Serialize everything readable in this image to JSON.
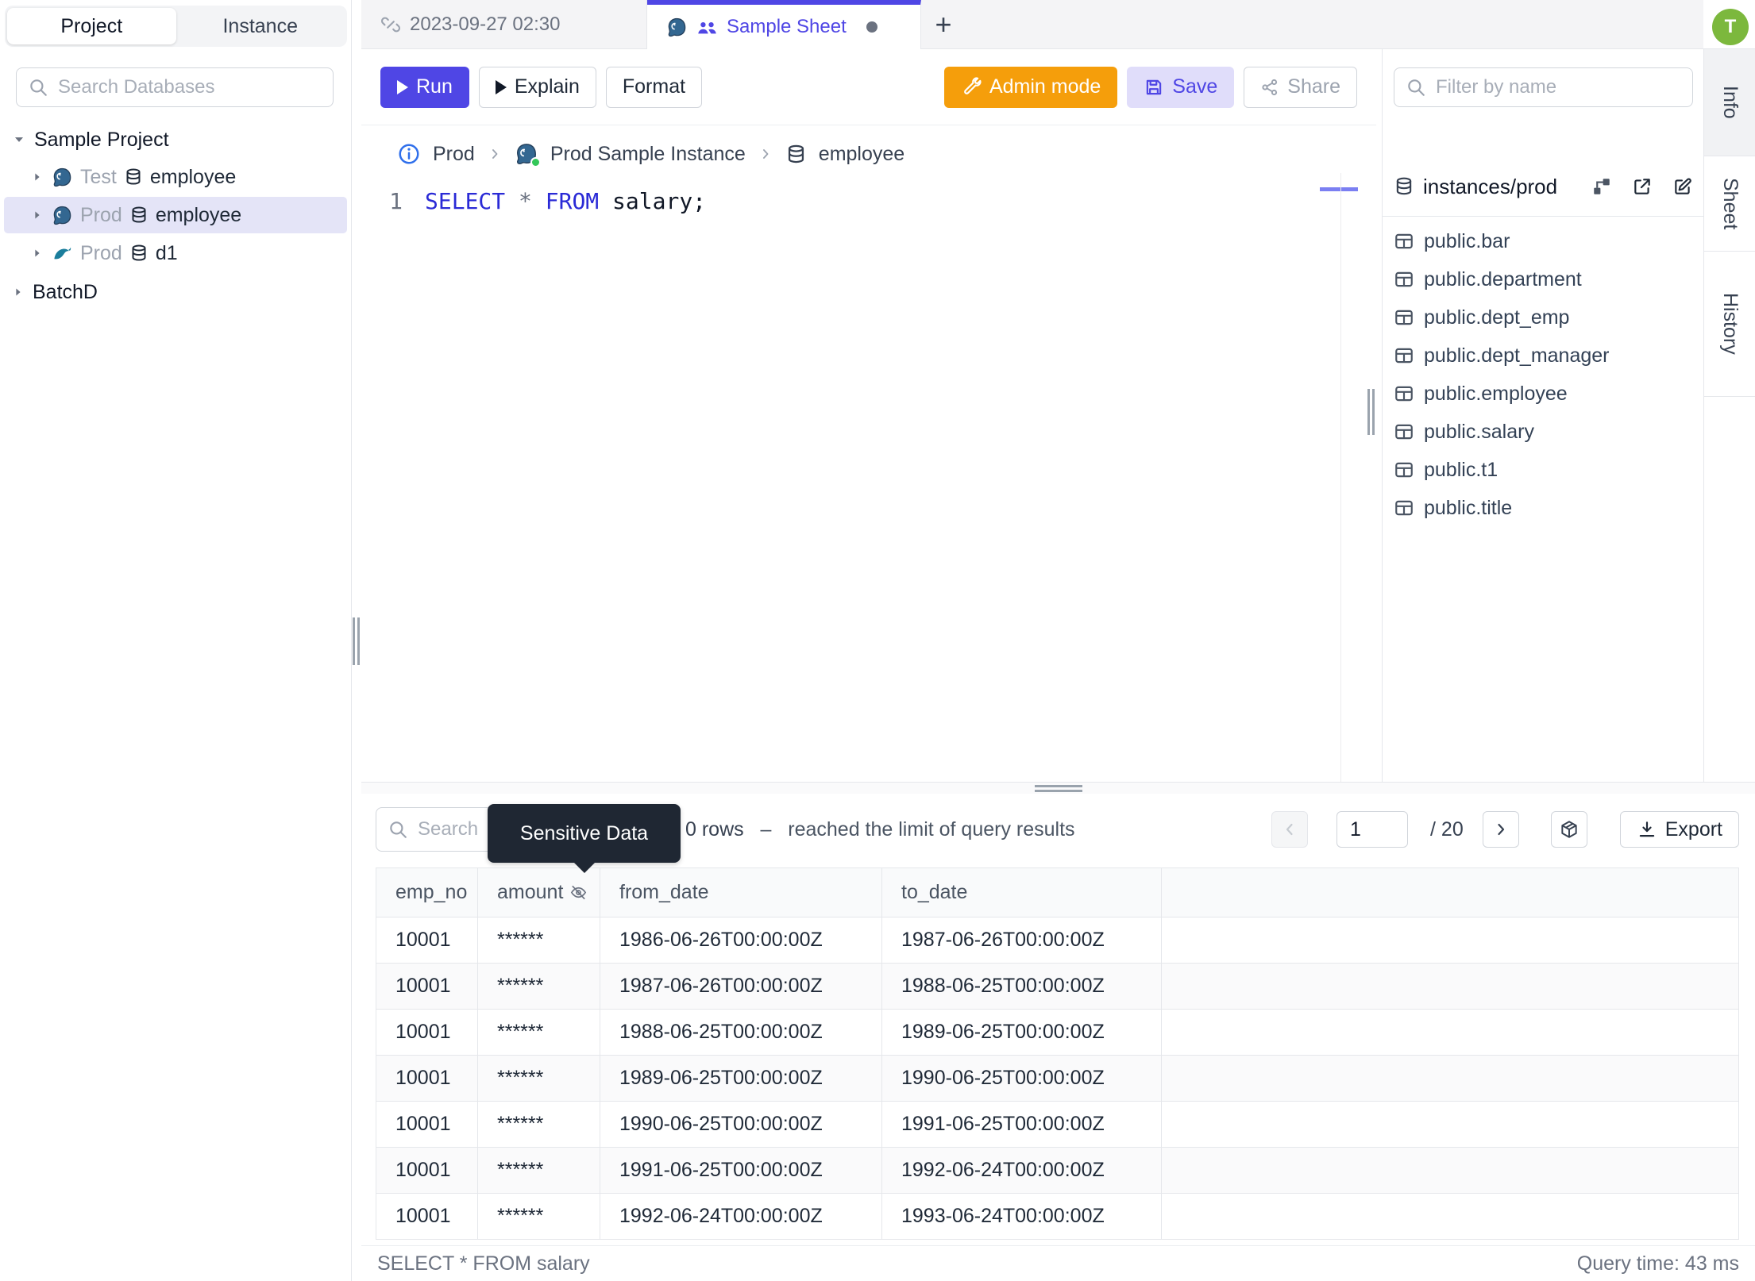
{
  "colors": {
    "accent": "#4f46e5",
    "admin_orange": "#f59e0b",
    "avatar_green": "#7cb83d",
    "keyword_blue": "#2a2ad6",
    "tooltip_bg": "#1f2733",
    "selected_row_bg": "#e4e4f7"
  },
  "left_sidebar": {
    "tab_project": "Project",
    "tab_instance": "Instance",
    "search_placeholder": "Search Databases",
    "tree_root": "Sample Project",
    "tree_items": [
      {
        "env": "Test",
        "db": "employee",
        "engine": "postgresql"
      },
      {
        "env": "Prod",
        "db": "employee",
        "engine": "postgresql"
      },
      {
        "env": "Prod",
        "db": "d1",
        "engine": "mysql"
      }
    ],
    "batch_item": "BatchD"
  },
  "tab_bar": {
    "tab1": "2023-09-27 02:30",
    "tab2": "Sample Sheet",
    "new_tab": "+"
  },
  "toolbar": {
    "run": "Run",
    "explain": "Explain",
    "format": "Format",
    "admin": "Admin mode",
    "save": "Save",
    "share": "Share"
  },
  "breadcrumb": {
    "env": "Prod",
    "instance": "Prod Sample Instance",
    "database": "employee"
  },
  "editor": {
    "line1_number": "1",
    "kw_select": "SELECT",
    "op_star": "*",
    "kw_from": "FROM",
    "tail": "salary;"
  },
  "right_sidebar": {
    "filter_placeholder": "Filter by name",
    "connection": "instances/prod",
    "tables": [
      "public.bar",
      "public.department",
      "public.dept_emp",
      "public.dept_manager",
      "public.employee",
      "public.salary",
      "public.t1",
      "public.title"
    ],
    "tab_info": "Info",
    "tab_sheet": "Sheet",
    "tab_history": "History"
  },
  "user": {
    "initial": "T"
  },
  "results": {
    "search_placeholder": "Search",
    "tooltip": "Sensitive Data",
    "row_count": "0 rows",
    "separator": "–",
    "limit_message": "reached the limit of query results",
    "page": "1",
    "page_total": "/ 20",
    "export": "Export",
    "columns": {
      "c1": "emp_no",
      "c2": "amount",
      "c3": "from_date",
      "c4": "to_date"
    },
    "rows": [
      [
        "10001",
        "******",
        "1986-06-26T00:00:00Z",
        "1987-06-26T00:00:00Z"
      ],
      [
        "10001",
        "******",
        "1987-06-26T00:00:00Z",
        "1988-06-25T00:00:00Z"
      ],
      [
        "10001",
        "******",
        "1988-06-25T00:00:00Z",
        "1989-06-25T00:00:00Z"
      ],
      [
        "10001",
        "******",
        "1989-06-25T00:00:00Z",
        "1990-06-25T00:00:00Z"
      ],
      [
        "10001",
        "******",
        "1990-06-25T00:00:00Z",
        "1991-06-25T00:00:00Z"
      ],
      [
        "10001",
        "******",
        "1991-06-25T00:00:00Z",
        "1992-06-24T00:00:00Z"
      ],
      [
        "10001",
        "******",
        "1992-06-24T00:00:00Z",
        "1993-06-24T00:00:00Z"
      ]
    ],
    "statement": "SELECT * FROM salary",
    "query_time": "Query time: 43 ms"
  }
}
